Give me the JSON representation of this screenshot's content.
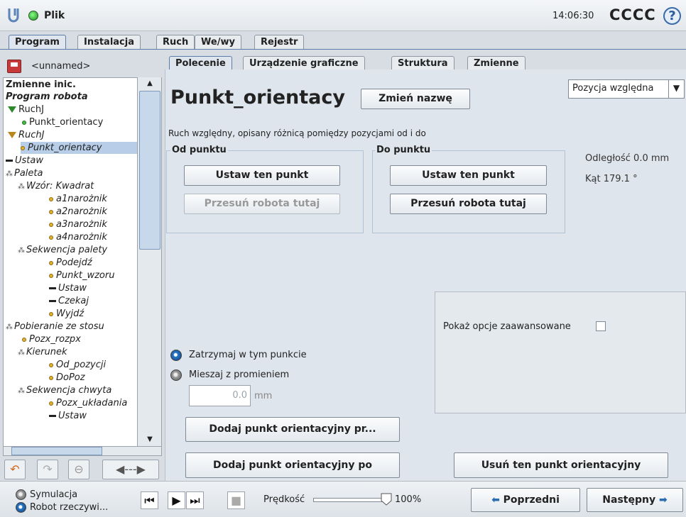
{
  "header": {
    "file": "Plik",
    "time": "14:06:30",
    "robot": "CCCC",
    "help": "?"
  },
  "main_tabs": [
    "Program",
    "Instalacja",
    "Ruch",
    "We/wy",
    "Rejestr"
  ],
  "program_name": "<unnamed>",
  "sub_tabs": [
    "Polecenie",
    "Urządzenie graficzne",
    "Struktura",
    "Zmienne"
  ],
  "tree": [
    "Zmienne inic.",
    "Program robota",
    "RuchJ",
    "Punkt_orientacy",
    "RuchJ",
    "Punkt_orientacy",
    "Ustaw",
    "Paleta",
    "Wzór: Kwadrat",
    "a1narożnik",
    "a2narożnik",
    "a3narożnik",
    "a4narożnik",
    "Sekwencja palety",
    "Podejdź",
    "Punkt_wzoru",
    "Ustaw",
    "Czekaj",
    "Wyjdź",
    "Pobieranie ze stosu",
    "Pozx_rozpx",
    "Kierunek",
    "Od_pozycji",
    "DoPoz",
    "Sekwencja chwyta",
    "Pozx_układania",
    "Ustaw"
  ],
  "command": {
    "title": "Punkt_orientacy",
    "rename": "Zmień nazwę",
    "mode": "Pozycja względna",
    "description": "Ruch względny, opisany różnicą pomiędzy pozycjami od i do",
    "from_label": "Od punktu",
    "to_label": "Do punktu",
    "set_point": "Ustaw ten punkt",
    "move_here": "Przesuń robota tutaj",
    "distance": "Odległość 0.0 mm",
    "angle": "Kąt 179.1 °",
    "advanced": "Pokaż opcje zaawansowane",
    "stop": "Zatrzymaj w tym punkcie",
    "blend": "Mieszaj z promieniem",
    "radius_value": "0.0",
    "radius_unit": "mm",
    "add_before": "Dodaj punkt orientacyjny pr...",
    "add_after": "Dodaj punkt orientacyjny po",
    "remove": "Usuń ten punkt orientacyjny"
  },
  "footer": {
    "sim": "Symulacja",
    "real": "Robot rzeczywi...",
    "speed_label": "Prędkość",
    "speed": "100%",
    "speed_fraction": 1.0,
    "prev": "Poprzedni",
    "next": "Następny"
  }
}
